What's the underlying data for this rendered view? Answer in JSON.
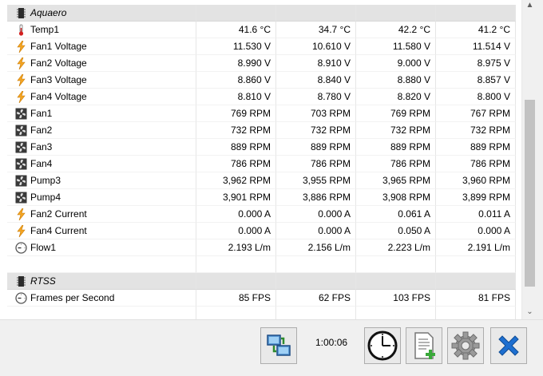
{
  "groups": [
    {
      "name": "Aquaero",
      "icon": "chip-icon",
      "rows": [
        {
          "icon": "thermometer-icon",
          "label": "Temp1",
          "current": "41.6 °C",
          "min": "34.7 °C",
          "max": "42.2 °C",
          "avg": "41.2 °C"
        },
        {
          "icon": "voltage-icon",
          "label": "Fan1 Voltage",
          "current": "11.530 V",
          "min": "10.610 V",
          "max": "11.580 V",
          "avg": "11.514 V"
        },
        {
          "icon": "voltage-icon",
          "label": "Fan2 Voltage",
          "current": "8.990 V",
          "min": "8.910 V",
          "max": "9.000 V",
          "avg": "8.975 V"
        },
        {
          "icon": "voltage-icon",
          "label": "Fan3 Voltage",
          "current": "8.860 V",
          "min": "8.840 V",
          "max": "8.880 V",
          "avg": "8.857 V"
        },
        {
          "icon": "voltage-icon",
          "label": "Fan4 Voltage",
          "current": "8.810 V",
          "min": "8.780 V",
          "max": "8.820 V",
          "avg": "8.800 V"
        },
        {
          "icon": "fan-icon",
          "label": "Fan1",
          "current": "769 RPM",
          "min": "703 RPM",
          "max": "769 RPM",
          "avg": "767 RPM"
        },
        {
          "icon": "fan-icon",
          "label": "Fan2",
          "current": "732 RPM",
          "min": "732 RPM",
          "max": "732 RPM",
          "avg": "732 RPM"
        },
        {
          "icon": "fan-icon",
          "label": "Fan3",
          "current": "889 RPM",
          "min": "889 RPM",
          "max": "889 RPM",
          "avg": "889 RPM"
        },
        {
          "icon": "fan-icon",
          "label": "Fan4",
          "current": "786 RPM",
          "min": "786 RPM",
          "max": "786 RPM",
          "avg": "786 RPM"
        },
        {
          "icon": "fan-icon",
          "label": "Pump3",
          "current": "3,962 RPM",
          "min": "3,955 RPM",
          "max": "3,965 RPM",
          "avg": "3,960 RPM"
        },
        {
          "icon": "fan-icon",
          "label": "Pump4",
          "current": "3,901 RPM",
          "min": "3,886 RPM",
          "max": "3,908 RPM",
          "avg": "3,899 RPM"
        },
        {
          "icon": "voltage-icon",
          "label": "Fan2 Current",
          "current": "0.000 A",
          "min": "0.000 A",
          "max": "0.061 A",
          "avg": "0.011 A"
        },
        {
          "icon": "voltage-icon",
          "label": "Fan4 Current",
          "current": "0.000 A",
          "min": "0.000 A",
          "max": "0.050 A",
          "avg": "0.000 A"
        },
        {
          "icon": "gauge-icon",
          "label": "Flow1",
          "current": "2.193 L/m",
          "min": "2.156 L/m",
          "max": "2.223 L/m",
          "avg": "2.191 L/m"
        }
      ]
    },
    {
      "name": "RTSS",
      "icon": "chip-icon",
      "rows": [
        {
          "icon": "gauge-icon",
          "label": "Frames per Second",
          "current": "85 FPS",
          "min": "62 FPS",
          "max": "103 FPS",
          "avg": "81 FPS"
        }
      ]
    }
  ],
  "toolbar": {
    "elapsed_time": "1:00:06",
    "buttons": [
      {
        "name": "network-button",
        "icon": "network-icon"
      },
      {
        "name": "clock-button",
        "icon": "clock-icon"
      },
      {
        "name": "log-button",
        "icon": "add-log-icon"
      },
      {
        "name": "settings-button",
        "icon": "gear-icon"
      },
      {
        "name": "close-button",
        "icon": "close-icon"
      }
    ]
  },
  "colors": {
    "group_bg": "#e3e3e3",
    "scroll_thumb": "#c2c2c2",
    "voltage_icon": "#f5a623",
    "close_icon": "#1e6fd0"
  }
}
